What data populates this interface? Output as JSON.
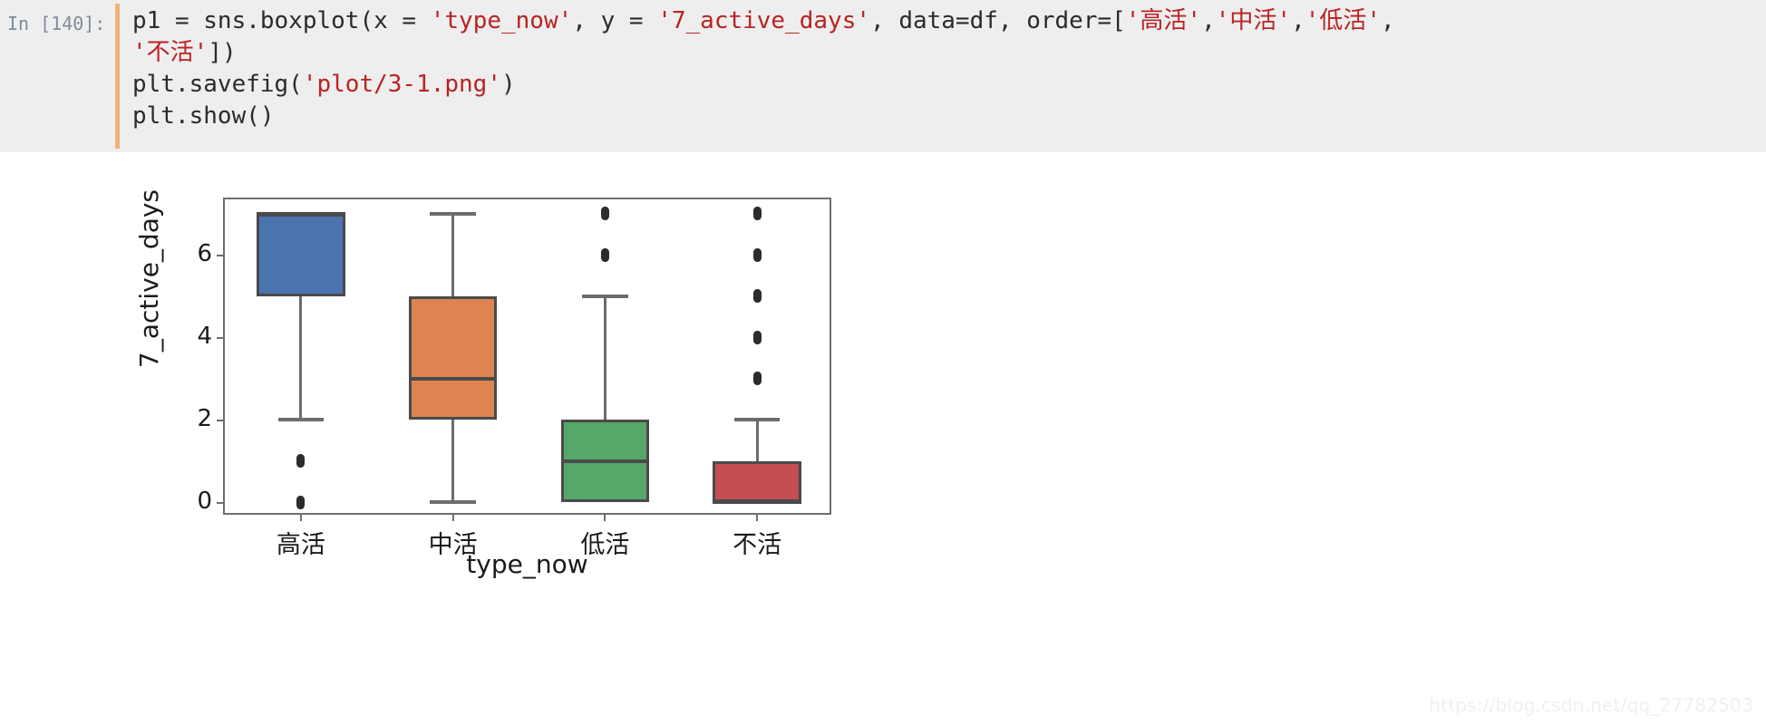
{
  "notebook": {
    "prompt": "In [140]:",
    "code_lines": [
      [
        {
          "t": "plain",
          "s": "p1 = sns.boxplot(x = "
        },
        {
          "t": "str",
          "s": "'type_now'"
        },
        {
          "t": "plain",
          "s": ", y = "
        },
        {
          "t": "str",
          "s": "'7_active_days'"
        },
        {
          "t": "plain",
          "s": ", data=df, order=["
        },
        {
          "t": "str",
          "s": "'高活'"
        },
        {
          "t": "plain",
          "s": ","
        },
        {
          "t": "str",
          "s": "'中活'"
        },
        {
          "t": "plain",
          "s": ","
        },
        {
          "t": "str",
          "s": "'低活'"
        },
        {
          "t": "plain",
          "s": ","
        }
      ],
      [
        {
          "t": "str",
          "s": "'不活'"
        },
        {
          "t": "plain",
          "s": "])"
        }
      ],
      [
        {
          "t": "plain",
          "s": "plt.savefig("
        },
        {
          "t": "str",
          "s": "'plot/3-1.png'"
        },
        {
          "t": "plain",
          "s": ")"
        }
      ],
      [
        {
          "t": "plain",
          "s": "plt.show()"
        }
      ]
    ]
  },
  "watermark": "https://blog.csdn.net/qq_27782503",
  "chart_data": {
    "type": "box",
    "title": "",
    "xlabel": "type_now",
    "ylabel": "7_active_days",
    "categories": [
      "高活",
      "中活",
      "低活",
      "不活"
    ],
    "yticks": [
      0,
      2,
      4,
      6
    ],
    "ylim": [
      -0.35,
      7.35
    ],
    "grid": false,
    "legend": null,
    "palette": [
      "#4C72B0",
      "#DD8452",
      "#55A868",
      "#C44E52"
    ],
    "boxes": [
      {
        "category": "高活",
        "color": "#4C72B0",
        "whisker_low": 2,
        "q1": 5,
        "median": 7,
        "q3": 7,
        "whisker_high": 7,
        "fliers": [
          1,
          0
        ]
      },
      {
        "category": "中活",
        "color": "#DD8452",
        "whisker_low": 0,
        "q1": 2,
        "median": 3,
        "q3": 5,
        "whisker_high": 7,
        "fliers": []
      },
      {
        "category": "低活",
        "color": "#55A868",
        "whisker_low": 0,
        "q1": 0,
        "median": 1,
        "q3": 2,
        "whisker_high": 5,
        "fliers": [
          7,
          6
        ]
      },
      {
        "category": "不活",
        "color": "#C44E52",
        "whisker_low": 0,
        "q1": 0,
        "median": 0,
        "q3": 1,
        "whisker_high": 2,
        "fliers": [
          7,
          6,
          5,
          4,
          3
        ]
      }
    ]
  }
}
